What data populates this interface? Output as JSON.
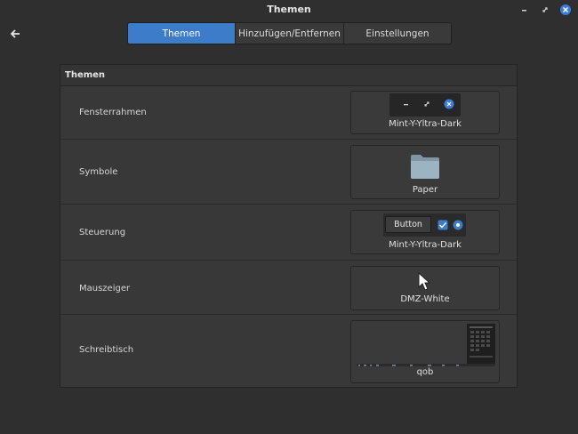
{
  "window": {
    "title": "Themen"
  },
  "tabs": [
    {
      "label": "Themen"
    },
    {
      "label": "Hinzufügen/Entfernen"
    },
    {
      "label": "Einstellungen"
    }
  ],
  "panel": {
    "title": "Themen",
    "rows": [
      {
        "label": "Fensterrahmen",
        "value": "Mint-Y-Yltra-Dark"
      },
      {
        "label": "Symbole",
        "value": "Paper"
      },
      {
        "label": "Steuerung",
        "value": "Mint-Y-Yltra-Dark",
        "preview_button": "Button"
      },
      {
        "label": "Mauszeiger",
        "value": "DMZ-White"
      },
      {
        "label": "Schreibtisch",
        "value": "qob"
      }
    ]
  },
  "colors": {
    "accent": "#3d7cc9",
    "background": "#2f2f2f",
    "panel": "#383838",
    "folder": "#8fa6b4"
  },
  "icons": [
    "back-arrow-icon",
    "minimize-icon",
    "restore-icon",
    "close-icon",
    "folder-icon",
    "cursor-icon",
    "checkbox-icon",
    "radio-icon"
  ]
}
